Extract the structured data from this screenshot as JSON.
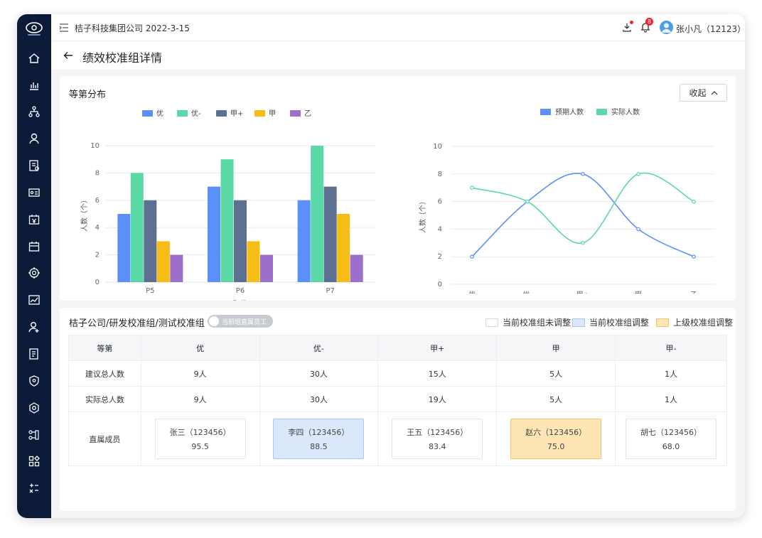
{
  "header": {
    "company": "桔子科技集团公司 2022-3-15",
    "notification_count": "8",
    "user": "张小凡（12123）"
  },
  "page": {
    "title": "绩效校准组详情"
  },
  "sidebar": {
    "items": [
      "home-icon",
      "bar-chart-icon",
      "org-chart-icon",
      "user-icon",
      "report-icon",
      "id-card-icon",
      "salary-icon",
      "calendar-icon",
      "target-icon",
      "trend-icon",
      "add-user-icon",
      "document-icon",
      "shield-icon",
      "settings-icon",
      "workflow-icon",
      "apps-icon",
      "calculator-icon"
    ]
  },
  "distribution": {
    "title": "等第分布",
    "collapse_label": "收起"
  },
  "colors": {
    "blue": "#5b8ff9",
    "green": "#5ad8a6",
    "slate": "#5d7092",
    "yellow": "#f6bd16",
    "purple": "#9c6fcc",
    "current_adjust": "#dbe8fc",
    "upper_adjust": "#fde5b4"
  },
  "chart_data": [
    {
      "type": "bar",
      "categories": [
        "P5",
        "P6",
        "P7"
      ],
      "series": [
        {
          "name": "优",
          "values": [
            5,
            7,
            6
          ],
          "color": "#5b8ff9"
        },
        {
          "name": "优-",
          "values": [
            8,
            9,
            10
          ],
          "color": "#5ad8a6"
        },
        {
          "name": "甲+",
          "values": [
            6,
            6,
            7
          ],
          "color": "#5d7092"
        },
        {
          "name": "甲",
          "values": [
            3,
            3,
            5
          ],
          "color": "#f6bd16"
        },
        {
          "name": "乙",
          "values": [
            2,
            2,
            2
          ],
          "color": "#9c6fcc"
        }
      ],
      "xlabel": "职级",
      "ylabel": "人数（个）",
      "yticks": [
        0,
        2,
        4,
        6,
        8,
        10
      ],
      "ylim": [
        0,
        10
      ],
      "grid": true,
      "legend": "top-center"
    },
    {
      "type": "line",
      "categories": [
        "优",
        "优-",
        "甲+",
        "甲",
        "乙"
      ],
      "series": [
        {
          "name": "预期人数",
          "values": [
            2,
            6,
            8,
            4,
            2
          ],
          "color": "#5b8ff9"
        },
        {
          "name": "实际人数",
          "values": [
            7,
            6,
            3,
            8,
            6
          ],
          "color": "#5ad8a6"
        }
      ],
      "ylabel": "人数（个）",
      "yticks": [
        0,
        2,
        4,
        6,
        8,
        10
      ],
      "ylim": [
        0,
        10
      ],
      "grid": true,
      "smooth": true,
      "legend": "top-center"
    }
  ],
  "group": {
    "path": "桔子公司/研发校准组/测试校准组",
    "toggle_label": "当前组直属员工",
    "legend": [
      "当前校准组未调整",
      "当前校准组调整",
      "上级校准组调整"
    ]
  },
  "table": {
    "headers": [
      "等第",
      "优",
      "优-",
      "甲+",
      "甲",
      "甲-"
    ],
    "rows": [
      [
        "建议总人数",
        "9人",
        "30人",
        "15人",
        "5人",
        "1人"
      ],
      [
        "实际总人数",
        "9人",
        "30人",
        "19人",
        "5人",
        "1人"
      ]
    ],
    "members_label": "直属成员",
    "members": [
      {
        "name": "张三（123456）",
        "score": "95.5",
        "status": "none"
      },
      {
        "name": "李四（123456）",
        "score": "88.5",
        "status": "current"
      },
      {
        "name": "王五（123456）",
        "score": "83.4",
        "status": "none"
      },
      {
        "name": "赵六（123456）",
        "score": "75.0",
        "status": "upper"
      },
      {
        "name": "胡七（123456）",
        "score": "68.0",
        "status": "none"
      }
    ]
  }
}
